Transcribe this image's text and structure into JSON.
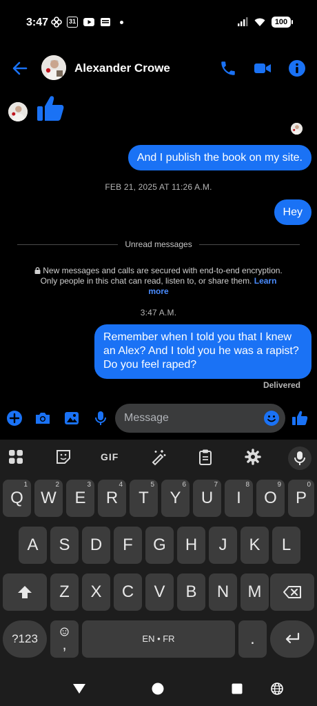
{
  "status_bar": {
    "time": "3:47",
    "calendar_day": "31",
    "battery": "100",
    "icons": [
      "pinwheel-icon",
      "calendar-icon",
      "youtube-icon",
      "message-icon",
      "dot-icon",
      "signal-icon",
      "wifi-icon",
      "battery-icon"
    ]
  },
  "header": {
    "contact_name": "Alexander Crowe",
    "icons": [
      "back-arrow-icon",
      "phone-icon",
      "video-icon",
      "info-icon"
    ],
    "accent_color": "#1a72f5"
  },
  "messages": {
    "m1": "And I publish the book on my site.",
    "timestamp1": "FEB 21, 2025 AT 11:26 A.M.",
    "m2": "Hey",
    "unread_label": "Unread messages",
    "e2e_notice": "New messages and calls are secured with end-to-end encryption. Only people in this chat can read, listen to, or share them.",
    "learn_more": "Learn more",
    "timestamp2": "3:47 A.M.",
    "m3": "Remember when I told you that I knew an Alex? And I told you he was a rapist? Do you feel raped?",
    "delivered": "Delivered"
  },
  "composer": {
    "placeholder": "Message",
    "icons": [
      "plus-icon",
      "camera-icon",
      "gallery-icon",
      "microphone-icon",
      "emoji-icon",
      "thumbs-up-icon"
    ]
  },
  "keyboard": {
    "toolbar": [
      "apps-icon",
      "sticker-icon",
      "gif-icon",
      "magic-pen-icon",
      "clipboard-icon",
      "settings-icon",
      "microphone-icon"
    ],
    "gif_label": "GIF",
    "row1": [
      "Q",
      "W",
      "E",
      "R",
      "T",
      "Y",
      "U",
      "I",
      "O",
      "P"
    ],
    "row1_hints": [
      "1",
      "2",
      "3",
      "4",
      "5",
      "6",
      "7",
      "8",
      "9",
      "0"
    ],
    "row2": [
      "A",
      "S",
      "D",
      "F",
      "G",
      "H",
      "J",
      "K",
      "L"
    ],
    "row3": [
      "Z",
      "X",
      "C",
      "V",
      "B",
      "N",
      "M"
    ],
    "symbols_key": "?123",
    "comma_key": ",",
    "space_label": "EN • FR",
    "period_key": "."
  },
  "navbar": {
    "icons": [
      "back-triangle-icon",
      "home-circle-icon",
      "recents-square-icon",
      "globe-icon"
    ]
  }
}
